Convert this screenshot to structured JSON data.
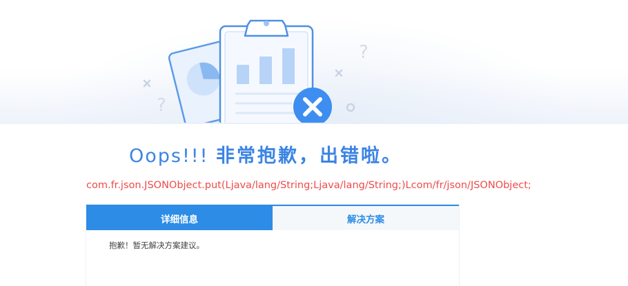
{
  "error_page": {
    "title_prefix": "Oops!!!",
    "title_main": "非常抱歉，出错啦。",
    "error_message": "com.fr.json.JSONObject.put(Ljava/lang/String;Ljava/lang/String;)Lcom/fr/json/JSONObject;"
  },
  "tabs": [
    {
      "label": "详细信息",
      "active": true
    },
    {
      "label": "解决方案",
      "active": false
    }
  ],
  "panel": {
    "content": "抱歉！暂无解决方案建议。"
  },
  "colors": {
    "accent": "#2d8ce6",
    "title": "#3b84e4",
    "error": "#ee4b4b"
  },
  "icons": {
    "illustration": "clipboard-error-illustration",
    "badge": "close-icon"
  }
}
